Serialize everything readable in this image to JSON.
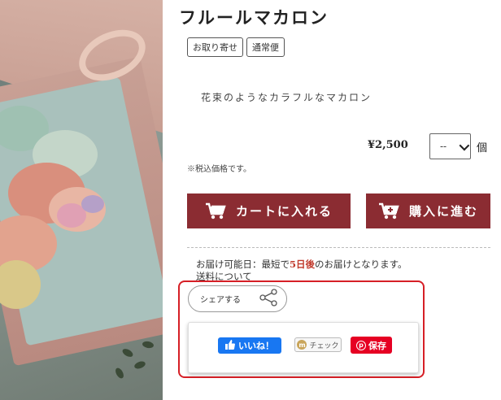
{
  "product": {
    "title": "フルールマカロン",
    "tags": [
      "お取り寄せ",
      "通常便"
    ],
    "description": "花束のようなカラフルなマカロン",
    "price": "¥2,500",
    "quantity_value": "--",
    "unit": "個",
    "tax_note": "※税込価格です。"
  },
  "actions": {
    "cart_label": "カートに入れる",
    "buy_label": "購入に進む",
    "accent_color": "#8b2c32"
  },
  "delivery": {
    "prefix": "お届け可能日：最短で",
    "days": "5日後",
    "suffix": "のお届けとなります。",
    "shipping_link": "送料について"
  },
  "share": {
    "label": "シェアする",
    "facebook_label": "いいね！",
    "mixi_label": "チェック",
    "pinterest_label": "保存"
  },
  "icons": {
    "cart": "cart-icon",
    "buy": "cart-plus-icon",
    "share": "share-icon",
    "facebook": "thumbs-up-icon",
    "mixi": "mixi-icon",
    "pinterest": "pinterest-icon"
  }
}
